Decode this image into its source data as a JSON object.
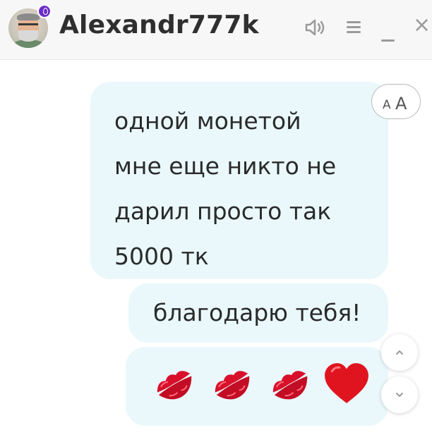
{
  "header": {
    "username": "Alexandr777k",
    "avatar_icon": "user-avatar",
    "online_badge_icon": "drop-icon",
    "sound_icon": "speaker-icon",
    "menu_icon": "hamburger-menu-icon",
    "minimize_icon": "minimize-icon",
    "close_icon": "close-icon",
    "close_glyph": "×"
  },
  "messages": [
    {
      "text": "одной монетой\nмне еще никто не\nдарил просто так\n5000 тк"
    },
    {
      "text": "благодарю тебя!"
    },
    {
      "emojis": [
        "kiss-mark-icon",
        "kiss-mark-icon",
        "kiss-mark-icon",
        "red-heart-icon"
      ]
    }
  ],
  "controls": {
    "font_size_small": "A",
    "font_size_big": "A",
    "scroll_up_icon": "chevron-up-icon",
    "scroll_down_icon": "chevron-down-icon"
  },
  "colors": {
    "bubble_bg": "#eaf8fc",
    "header_bg": "#f7f7f7",
    "badge": "#6c2cc9",
    "kiss_red": "#d8102a",
    "heart_red": "#e0141f"
  }
}
